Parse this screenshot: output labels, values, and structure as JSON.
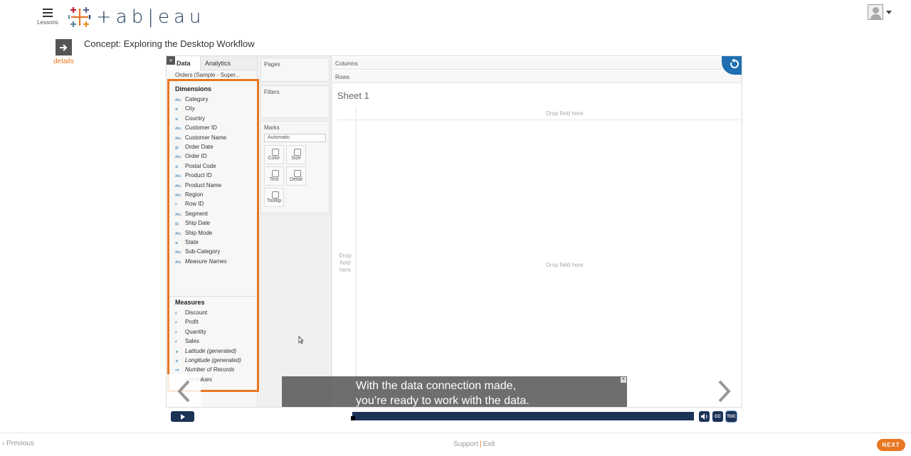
{
  "header": {
    "menu_label": "Lessons",
    "logo_text": "+ab|eau"
  },
  "lesson": {
    "title": "Concept: Exploring the Desktop Workflow",
    "details_label": "details"
  },
  "video": {
    "tabs": [
      "Data",
      "Analytics"
    ],
    "data_source": "Orders (Sample - Super...",
    "dimensions_title": "Dimensions",
    "dimensions": [
      {
        "icon": "Abc",
        "label": "Category"
      },
      {
        "icon": "⊕",
        "label": "City"
      },
      {
        "icon": "⊕",
        "label": "Country"
      },
      {
        "icon": "Abc",
        "label": "Customer ID"
      },
      {
        "icon": "Abc",
        "label": "Customer Name"
      },
      {
        "icon": "▤",
        "label": "Order Date"
      },
      {
        "icon": "Abc",
        "label": "Order ID"
      },
      {
        "icon": "⊕",
        "label": "Postal Code"
      },
      {
        "icon": "Abc",
        "label": "Product ID"
      },
      {
        "icon": "Abc",
        "label": "Product Name"
      },
      {
        "icon": "Abc",
        "label": "Region"
      },
      {
        "icon": "#",
        "label": "Row ID"
      },
      {
        "icon": "Abc",
        "label": "Segment"
      },
      {
        "icon": "▤",
        "label": "Ship Date"
      },
      {
        "icon": "Abc",
        "label": "Ship Mode"
      },
      {
        "icon": "⊕",
        "label": "State"
      },
      {
        "icon": "Abc",
        "label": "Sub-Category"
      },
      {
        "icon": "Abc",
        "label": "Measure Names",
        "italic": true
      }
    ],
    "measures_title": "Measures",
    "measures": [
      {
        "icon": "#",
        "label": "Discount"
      },
      {
        "icon": "#",
        "label": "Profit"
      },
      {
        "icon": "#",
        "label": "Quantity"
      },
      {
        "icon": "#",
        "label": "Sales"
      },
      {
        "icon": "⊕",
        "label": "Latitude (generated)",
        "italic": true
      },
      {
        "icon": "⊕",
        "label": "Longitude (generated)",
        "italic": true
      },
      {
        "icon": "=#",
        "label": "Number of Records",
        "italic": true
      },
      {
        "icon": "#",
        "label": "ure Values",
        "italic": true
      }
    ],
    "shelves": {
      "pages": "Pages",
      "filters": "Filters",
      "marks": "Marks",
      "marks_type": "Automatic",
      "mark_buttons": [
        "Color",
        "Size",
        "Text",
        "Detail",
        "Tooltip"
      ]
    },
    "columns_label": "Columns",
    "rows_label": "Rows",
    "sheet_title": "Sheet 1",
    "drop_field": "Drop field here",
    "drop_field_left": "Drop field here",
    "caption_line1": "With the data connection made,",
    "caption_line2": "you’re ready to work with the data."
  },
  "player": {
    "volume_icon": "volume-icon",
    "cc_label": "CC",
    "toc_label": "TOC",
    "progress": 0.0
  },
  "footer": {
    "previous": "Previous",
    "support": "Support",
    "exit": "Exit",
    "next": "NEXT"
  },
  "colors": {
    "accent": "#e87722",
    "navy": "#1c3257",
    "tableau_blue": "#1f6fb2"
  }
}
